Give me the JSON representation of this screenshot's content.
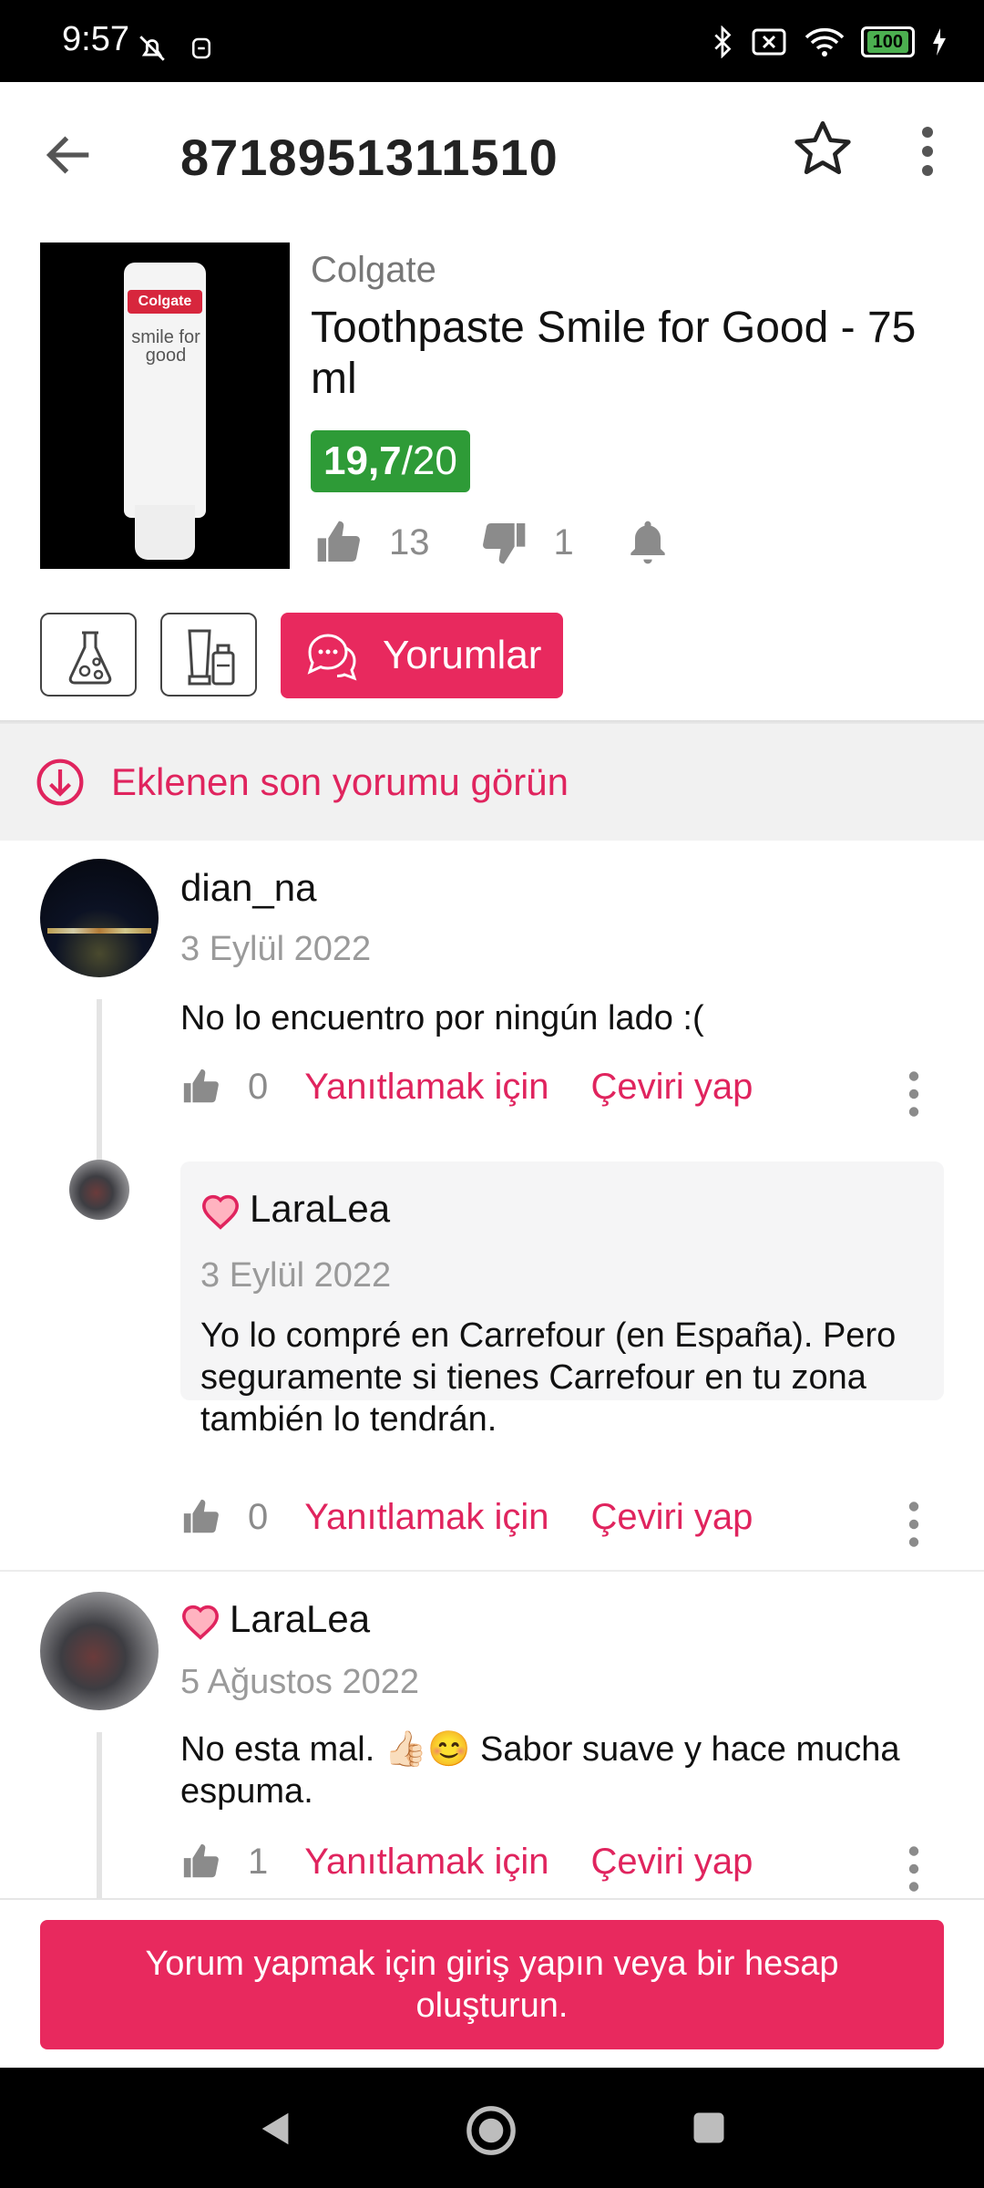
{
  "status_bar": {
    "time": "9:57",
    "battery": "100"
  },
  "app_bar": {
    "title": "8718951311510"
  },
  "product": {
    "brand": "Colgate",
    "name": "Toothpaste Smile for Good - 75 ml",
    "score_main": "19,7",
    "score_suffix": "/20",
    "likes": "13",
    "dislikes": "1",
    "image_label": {
      "logo": "Colgate",
      "text": "smile for good"
    }
  },
  "tabs": {
    "comments_label": "Yorumlar"
  },
  "newest_banner": "Eklenen son yorumu görün",
  "comments": [
    {
      "user": "dian_na",
      "date": "3 Eylül 2022",
      "text": "No lo encuentro por ningún lado :(",
      "likes": "0",
      "reply_label": "Yanıtlamak için",
      "translate_label": "Çeviri yap",
      "replies": [
        {
          "user": "LaraLea",
          "date": "3 Eylül 2022",
          "text": "Yo lo compré en Carrefour (en España). Pero seguramente si tienes Carrefour en tu zona también lo tendrán.",
          "likes": "0",
          "reply_label": "Yanıtlamak için",
          "translate_label": "Çeviri yap"
        }
      ]
    },
    {
      "user": "LaraLea",
      "date": "5 Ağustos 2022",
      "text": "No esta mal. 👍🏻😊 Sabor suave y hace mucha espuma.",
      "likes": "1",
      "reply_label": "Yanıtlamak için",
      "translate_label": "Çeviri yap"
    }
  ],
  "login_prompt": "Yorum yapmak için giriş yapın veya bir hesap oluşturun.",
  "colors": {
    "accent": "#e8295e",
    "score_green": "#2e9b37",
    "muted": "#8b8b8b"
  }
}
